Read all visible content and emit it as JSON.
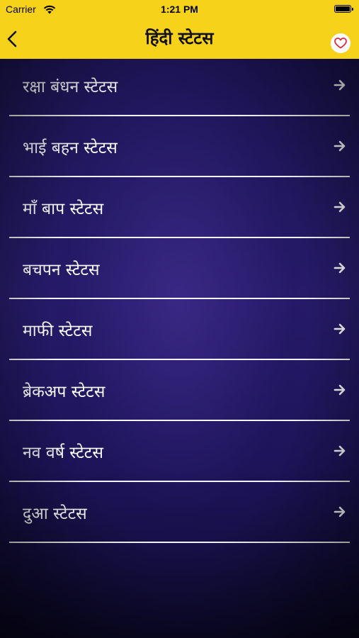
{
  "status_bar": {
    "carrier": "Carrier",
    "time": "1:21 PM"
  },
  "nav": {
    "title": "हिंदी स्टेटस",
    "back_icon": "chevron-left-icon",
    "favorite_icon": "heart-icon"
  },
  "colors": {
    "accent": "#f7d21a",
    "list_text": "#ffffff",
    "background": "#1d145a"
  },
  "list": {
    "items": [
      {
        "label": "रक्षा बंधन स्टेटस"
      },
      {
        "label": "भाई बहन स्टेटस"
      },
      {
        "label": "माँ बाप स्टेटस"
      },
      {
        "label": "बचपन स्टेटस"
      },
      {
        "label": "माफी स्टेटस"
      },
      {
        "label": "ब्रेकअप स्टेटस"
      },
      {
        "label": "नव वर्ष स्टेटस"
      },
      {
        "label": "दुआ स्टेटस"
      },
      {
        "label": ""
      }
    ]
  }
}
